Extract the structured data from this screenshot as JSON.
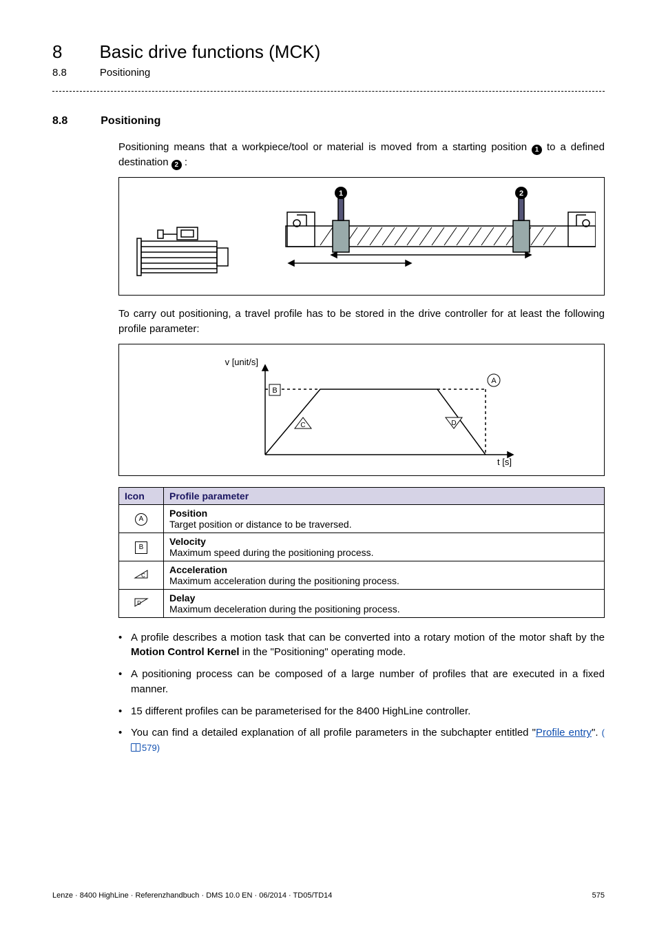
{
  "chapter": {
    "num": "8",
    "title": "Basic drive functions (MCK)"
  },
  "subchapter": {
    "num": "8.8",
    "title": "Positioning"
  },
  "section": {
    "num": "8.8",
    "title": "Positioning"
  },
  "intro": {
    "part1": "Positioning means that a workpiece/tool or material is moved from a starting position ",
    "marker1": "1",
    "part2": " to a defined destination ",
    "marker2": "2",
    "part3": ":"
  },
  "figure1": {
    "marker1": "1",
    "marker2": "2"
  },
  "after_fig1": "To carry out positioning, a travel profile has to be stored in the drive controller for at least the following profile parameter:",
  "figure2": {
    "ylabel": "v [unit/s]",
    "xlabel": "t [s]",
    "markA": "A",
    "markB": "B",
    "markC": "C",
    "markD": "D"
  },
  "table": {
    "headers": {
      "icon": "Icon",
      "param": "Profile parameter"
    },
    "rows": [
      {
        "iconKind": "circleA",
        "iconLetter": "A",
        "title": "Position",
        "desc": "Target position or distance to be traversed."
      },
      {
        "iconKind": "squareB",
        "iconLetter": "B",
        "title": "Velocity",
        "desc": "Maximum speed during the positioning process."
      },
      {
        "iconKind": "triUp",
        "iconLetter": "C",
        "title": "Acceleration",
        "desc": "Maximum acceleration during the positioning process."
      },
      {
        "iconKind": "triDown",
        "iconLetter": "D",
        "title": "Delay",
        "desc": "Maximum deceleration during the positioning process."
      }
    ]
  },
  "bullets": [
    {
      "pre": "A profile describes a motion task that can be converted into a rotary motion of the motor shaft by the ",
      "bold": "Motion Control Kernel",
      "post": " in the \"Positioning\" operating mode."
    },
    {
      "text": "A positioning process can be composed of a large number of profiles that are executed in a fixed manner."
    },
    {
      "text": "15 different profiles can be parameterised for the 8400 HighLine controller."
    },
    {
      "pre": "You can find a detailed explanation of all profile parameters in the subchapter entitled \"",
      "link": "Profile entry",
      "post": "\". ",
      "ref": "579)"
    }
  ],
  "footer": {
    "left": "Lenze · 8400 HighLine · Referenzhandbuch · DMS 10.0 EN · 06/2014 · TD05/TD14",
    "right": "575"
  }
}
